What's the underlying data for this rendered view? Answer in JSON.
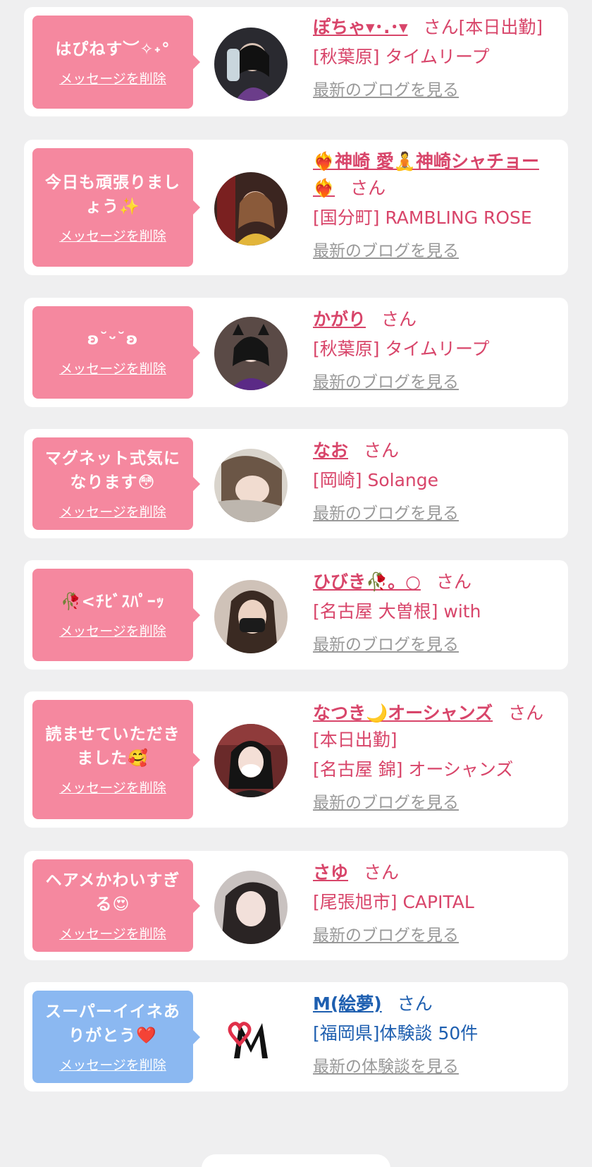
{
  "cards": [
    {
      "message": "はぴねす︶✧˖°",
      "delete_label": "メッセージを削除",
      "name": "ぽちゃ▾･.･▾",
      "suffix": "さん",
      "tag": "[本日出勤]",
      "shop": "[秋葉原] タイムリープ",
      "blog_label": "最新のブログを見る"
    },
    {
      "message": "今日も頑張りましょう✨",
      "delete_label": "メッセージを削除",
      "name": "❤‍🔥神崎 愛🧘神崎シャチョー❤‍🔥",
      "suffix": "さん",
      "tag": "",
      "shop": "[国分町] RAMBLING ROSE",
      "blog_label": "最新のブログを見る"
    },
    {
      "message": "ʚ˘ᵕ˘ʚ",
      "delete_label": "メッセージを削除",
      "name": "かがり",
      "suffix": "さん",
      "tag": "",
      "shop": "[秋葉原] タイムリープ",
      "blog_label": "最新のブログを見る"
    },
    {
      "message": "マグネット式気になります😳",
      "delete_label": "メッセージを削除",
      "name": "なお",
      "suffix": "さん",
      "tag": "",
      "shop": "[岡崎] Solange",
      "blog_label": "最新のブログを見る"
    },
    {
      "message": "🥀<ﾁﾋﾞｽﾊﾟｰｯ",
      "delete_label": "メッセージを削除",
      "name": "ひびき🥀。○",
      "suffix": "さん",
      "tag": "",
      "shop": "[名古屋 大曽根] with",
      "blog_label": "最新のブログを見る"
    },
    {
      "message": "読ませていただきました🥰",
      "delete_label": "メッセージを削除",
      "name": "なつき🌙オーシャンズ",
      "suffix": "さん",
      "tag": "[本日出勤]",
      "shop": "[名古屋 錦] オーシャンズ",
      "blog_label": "最新のブログを見る"
    },
    {
      "message": "ヘアメかわいすぎる😍",
      "delete_label": "メッセージを削除",
      "name": "さゆ",
      "suffix": "さん",
      "tag": "",
      "shop": "[尾張旭市] CAPITAL",
      "blog_label": "最新のブログを見る"
    },
    {
      "message": "スーパーイイネありがとう❤️",
      "delete_label": "メッセージを削除",
      "name": "M(絵夢)",
      "suffix": "さん",
      "tag": "",
      "shop": "[福岡県]体験談 50件",
      "blog_label": "最新の体験談を見る"
    }
  ],
  "colors": {
    "accent_pink": "#f5889f",
    "accent_blue": "#8bb8f1",
    "name_pink": "#d8456a",
    "name_blue": "#1e5fb0",
    "link_gray": "#999999"
  }
}
